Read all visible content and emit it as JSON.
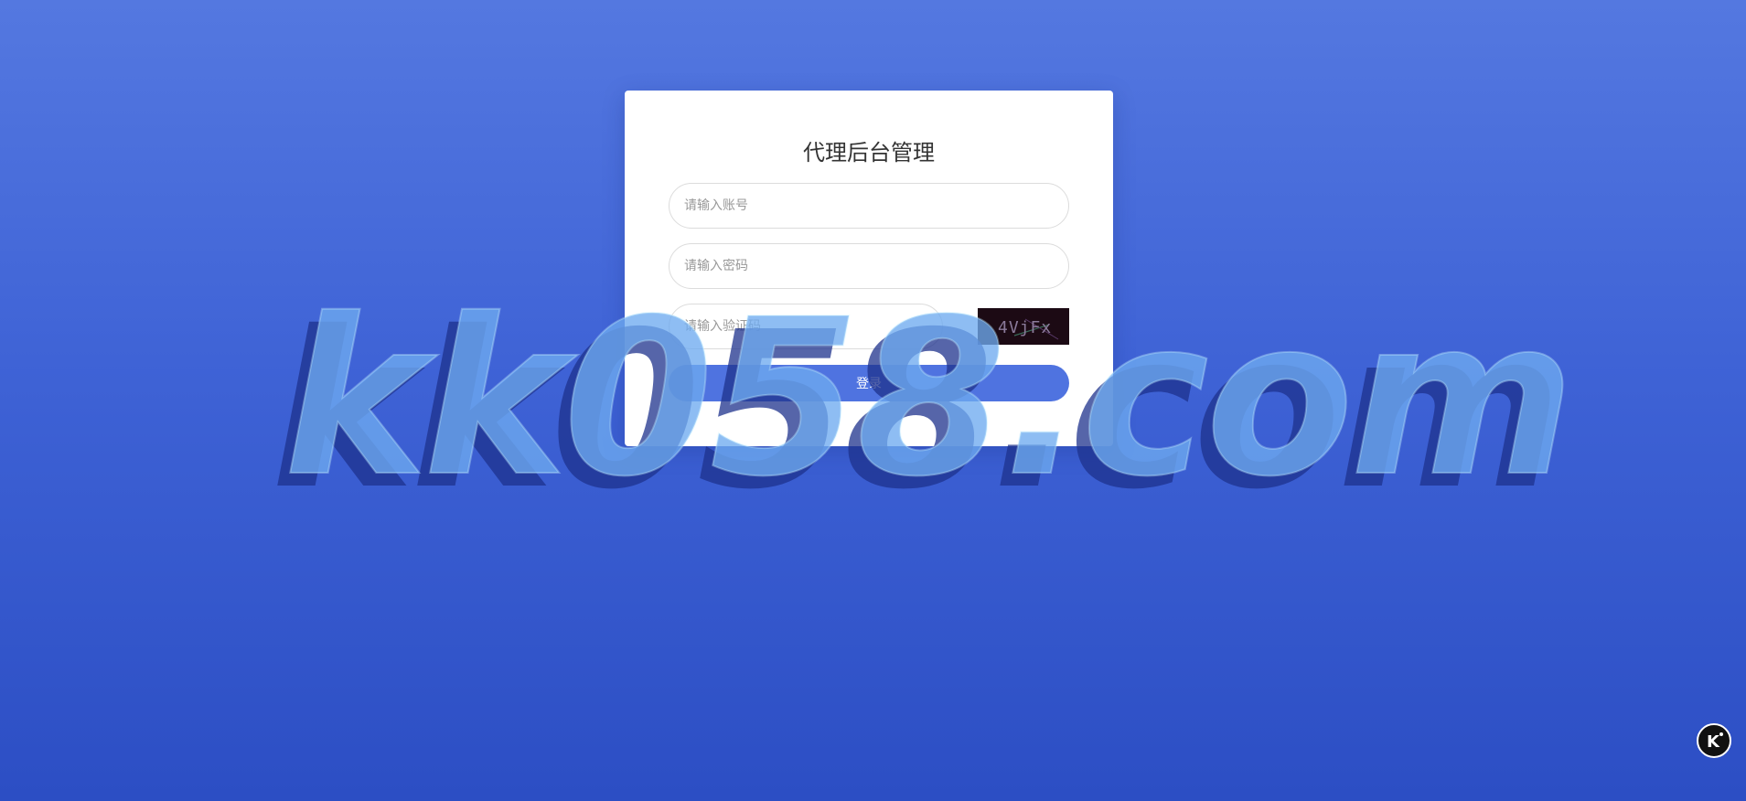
{
  "login": {
    "title": "代理后台管理",
    "username_placeholder": "请输入账号",
    "password_placeholder": "请输入密码",
    "captcha_placeholder": "请输入验证码",
    "captcha_text": "4VjFx",
    "submit_label": "登录"
  },
  "watermark": {
    "text": "kk058.com"
  },
  "badge": {
    "icon": "k-logo-icon",
    "letter": "K"
  },
  "colors": {
    "background_top": "#5478e0",
    "background_bottom": "#2c4ec4",
    "button": "#4f73e0",
    "card": "#ffffff",
    "captcha_background": "#1c0a14"
  }
}
